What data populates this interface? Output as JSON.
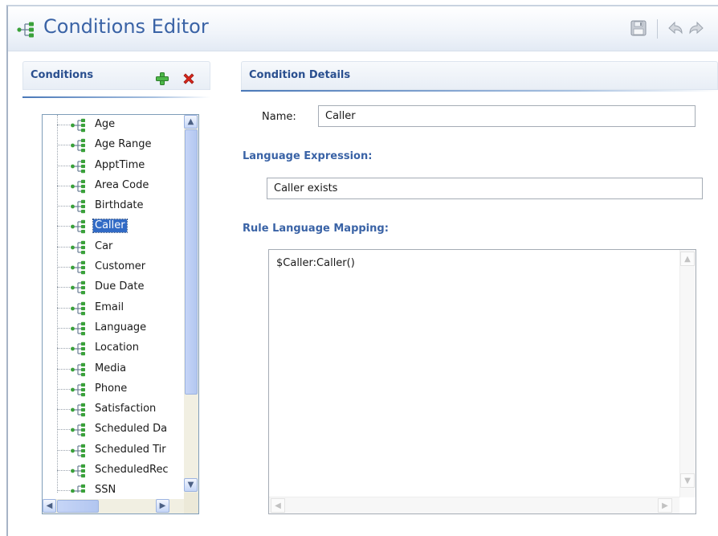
{
  "editor": {
    "title": "Conditions Editor",
    "toolbar": {
      "save_icon": "save-icon",
      "undo_icon": "undo-icon",
      "redo_icon": "redo-icon"
    }
  },
  "conditions_panel": {
    "header": "Conditions",
    "add_icon": "add-icon",
    "delete_icon": "delete-icon",
    "items": [
      {
        "label": "Age"
      },
      {
        "label": "Age Range"
      },
      {
        "label": "ApptTime"
      },
      {
        "label": "Area Code"
      },
      {
        "label": "Birthdate"
      },
      {
        "label": "Caller",
        "selected": true
      },
      {
        "label": "Car"
      },
      {
        "label": "Customer"
      },
      {
        "label": "Due Date"
      },
      {
        "label": "Email"
      },
      {
        "label": "Language"
      },
      {
        "label": "Location"
      },
      {
        "label": "Media"
      },
      {
        "label": "Phone"
      },
      {
        "label": "Satisfaction"
      },
      {
        "label": "Scheduled Da"
      },
      {
        "label": "Scheduled Tir"
      },
      {
        "label": "ScheduledRec"
      },
      {
        "label": "SSN"
      }
    ]
  },
  "details_panel": {
    "header": "Condition Details",
    "name_label": "Name:",
    "name_value": "Caller",
    "language_expression_label": "Language Expression:",
    "language_expression_value": "Caller exists",
    "rule_mapping_label": "Rule Language Mapping:",
    "rule_mapping_value": "$Caller:Caller()"
  },
  "colors": {
    "accent": "#3a63a6",
    "selection": "#316ac5",
    "icon_green": "#3aa13a",
    "delete_red": "#d8261c"
  }
}
